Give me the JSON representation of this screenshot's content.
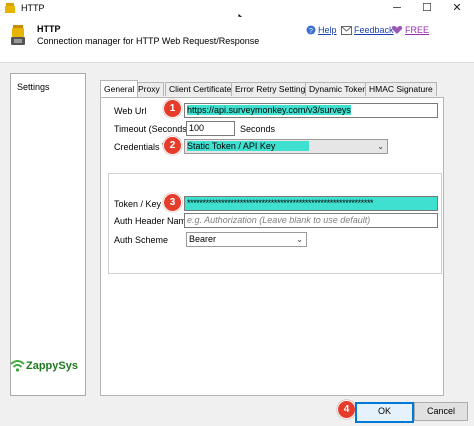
{
  "window": {
    "title": "HTTP",
    "minimize": "─",
    "maximize": "☐",
    "close": "✕"
  },
  "header": {
    "title": "HTTP",
    "subtitle": "Connection manager for HTTP Web Request/Response",
    "help_label": "Help",
    "feedback_label": "Feedback",
    "free_label": "FREE"
  },
  "sidebar": {
    "items": [
      {
        "label": "Settings"
      }
    ]
  },
  "logo": {
    "text": "ZappySys"
  },
  "tabs": [
    {
      "label": "General"
    },
    {
      "label": "Proxy"
    },
    {
      "label": "Client Certificate"
    },
    {
      "label": "Error Retry Settings"
    },
    {
      "label": "Dynamic Token"
    },
    {
      "label": "HMAC Signature"
    }
  ],
  "form": {
    "web_url_label": "Web Url",
    "web_url_value": "https://api.surveymonkey.com/v3/surveys",
    "timeout_label": "Timeout (Seconds)",
    "timeout_value": "100",
    "timeout_unit": "Seconds",
    "cred_label": "Credentials Typ",
    "cred_value": "Static Token / API Key",
    "token_label": "Token / Key",
    "token_value": "************************************************************",
    "auth_header_label": "Auth Header Name",
    "auth_header_placeholder": "e.g. Authorization    (Leave blank to use default)",
    "auth_scheme_label": "Auth Scheme",
    "auth_scheme_value": "Bearer"
  },
  "callouts": {
    "one": "1",
    "two": "2",
    "three": "3",
    "four": "4"
  },
  "footer": {
    "ok_label": "OK",
    "cancel_label": "Cancel"
  },
  "colors": {
    "highlight": "#40e0d0",
    "callout": "#e53c2c",
    "link": "#1a3fb0",
    "accent": "#0078d7"
  }
}
